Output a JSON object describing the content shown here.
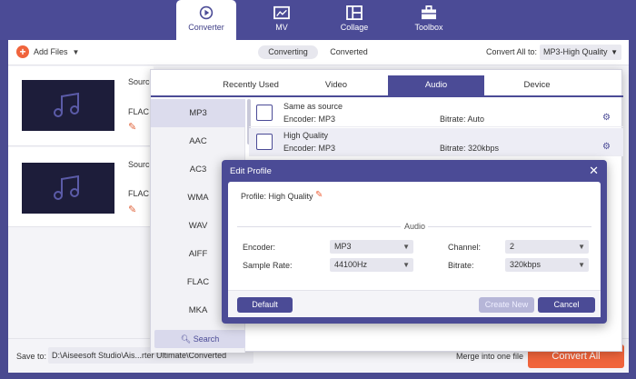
{
  "nav": {
    "items": [
      {
        "label": "Converter",
        "icon": "converter-icon",
        "active": true
      },
      {
        "label": "MV",
        "icon": "mv-icon",
        "active": false
      },
      {
        "label": "Collage",
        "icon": "collage-icon",
        "active": false
      },
      {
        "label": "Toolbox",
        "icon": "toolbox-icon",
        "active": false
      }
    ]
  },
  "toolbar": {
    "add_files": "Add Files",
    "tab_converting": "Converting",
    "tab_converted": "Converted",
    "convert_all_label": "Convert All to:",
    "convert_all_value": "MP3-High Quality"
  },
  "files": [
    {
      "source": "Source",
      "format": "FLAC"
    },
    {
      "source": "Source",
      "format": "FLAC"
    }
  ],
  "save": {
    "label": "Save to:",
    "path": "D:\\Aiseesoft Studio\\Ais...rter Ultimate\\Converted",
    "merge": "Merge into one file",
    "convert_all_button": "Convert All"
  },
  "format_panel": {
    "tabs": [
      "Recently Used",
      "Video",
      "Audio",
      "Device"
    ],
    "selected_tab": "Audio",
    "formats": [
      "MP3",
      "AAC",
      "AC3",
      "WMA",
      "WAV",
      "AIFF",
      "FLAC",
      "MKA"
    ],
    "selected_format": "MP3",
    "search": "Search",
    "presets": [
      {
        "name": "Same as source",
        "encoder": "Encoder: MP3",
        "bitrate": "Bitrate: Auto"
      },
      {
        "name": "High Quality",
        "encoder": "Encoder: MP3",
        "bitrate": "Bitrate: 320kbps"
      }
    ]
  },
  "edit_profile": {
    "title": "Edit Profile",
    "profile_label": "Profile:",
    "profile_value": "High Quality",
    "section": "Audio",
    "encoder_label": "Encoder:",
    "encoder_value": "MP3",
    "channel_label": "Channel:",
    "channel_value": "2",
    "sample_rate_label": "Sample Rate:",
    "sample_rate_value": "44100Hz",
    "bitrate_label": "Bitrate:",
    "bitrate_value": "320kbps",
    "default_button": "Default",
    "create_new_button": "Create New",
    "cancel_button": "Cancel"
  },
  "colors": {
    "accent": "#4b4b96",
    "orange": "#f0643c"
  }
}
